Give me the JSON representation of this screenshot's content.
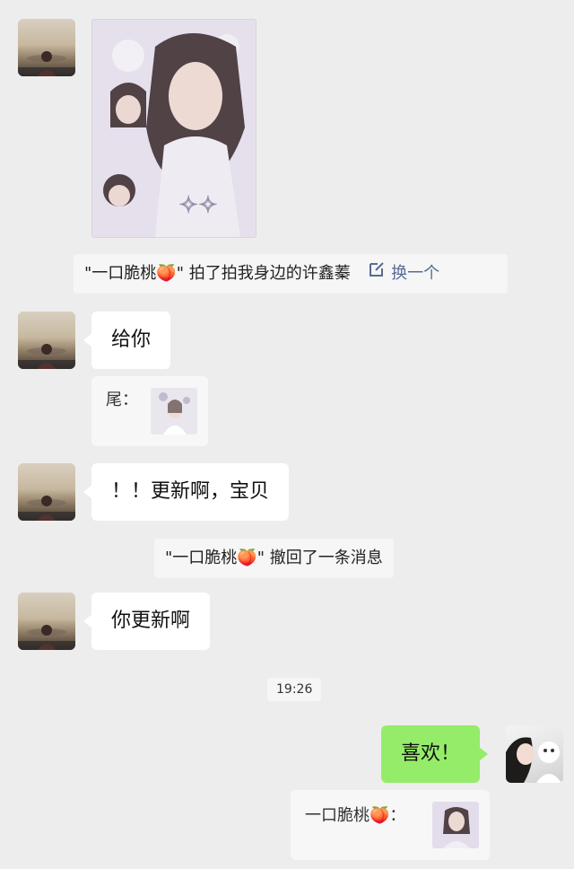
{
  "messages": {
    "pat": {
      "text": "\"一口脆桃🍑\" 拍了拍我身边的许鑫蓁",
      "action_label": "换一个"
    },
    "msg1": {
      "text": "给你"
    },
    "msg1_quote": {
      "label": "尾："
    },
    "msg2": {
      "text": "！！更新啊，宝贝"
    },
    "recall": {
      "text": "\"一口脆桃🍑\" 撤回了一条消息"
    },
    "msg3": {
      "text": "你更新啊"
    },
    "time": "19:26",
    "reply": {
      "text": "喜欢！"
    },
    "reply_quote": {
      "label": "一口脆桃🍑："
    }
  },
  "colors": {
    "background": "#ededed",
    "bubble_incoming": "#ffffff",
    "bubble_outgoing": "#95ec69",
    "link": "#576b95"
  },
  "icons": {
    "edit": "edit-icon"
  }
}
